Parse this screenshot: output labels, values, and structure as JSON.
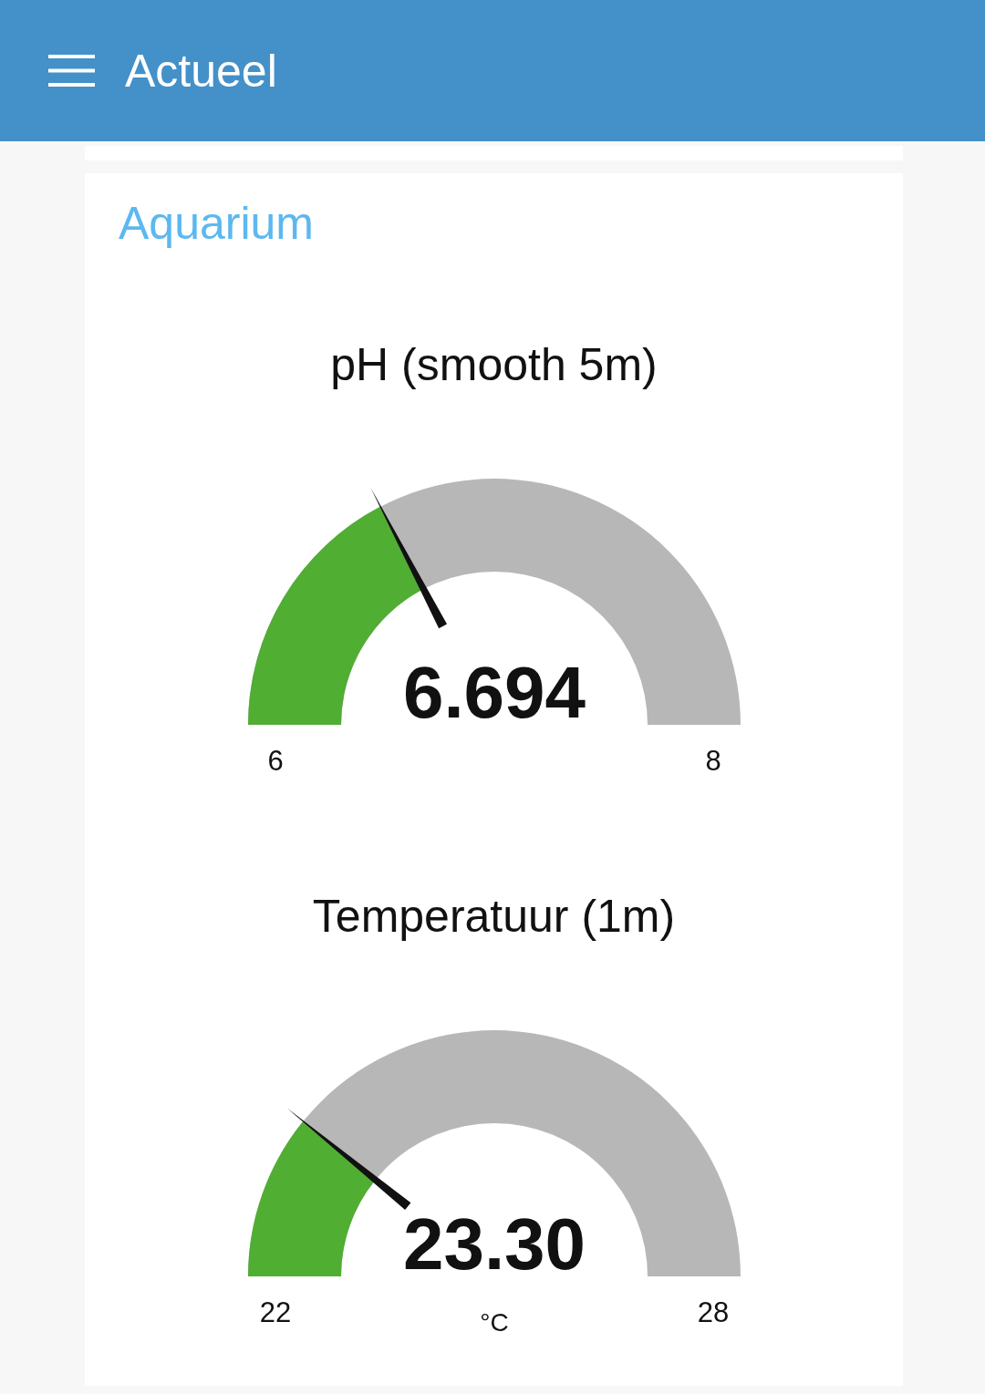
{
  "header": {
    "title": "Actueel"
  },
  "group": {
    "title": "Aquarium"
  },
  "gauges": [
    {
      "title": "pH (smooth 5m)",
      "value": "6.694",
      "min": "6",
      "max": "8",
      "level": 0.347
    },
    {
      "title": "Temperatuur (1m)",
      "value": "23.30",
      "unit": "°C",
      "min": "22",
      "max": "28",
      "level": 0.217
    }
  ]
}
